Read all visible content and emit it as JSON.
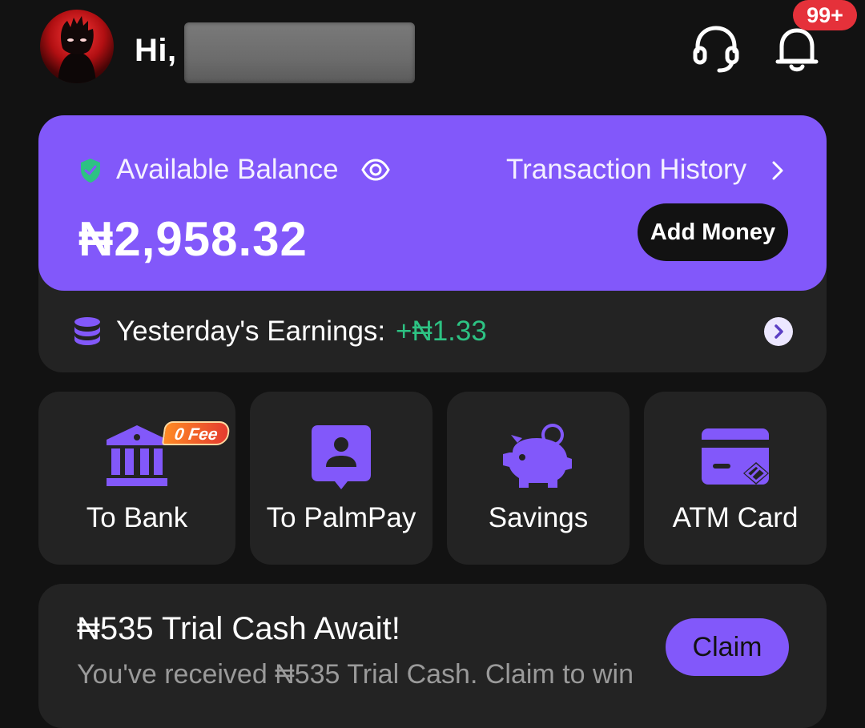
{
  "header": {
    "greeting": "Hi,",
    "notification_badge": "99+",
    "icons": {
      "avatar": "avatar-image",
      "support": "headset-icon",
      "notifications": "bell-icon"
    }
  },
  "balance": {
    "label": "Available Balance",
    "amount": "₦2,958.32",
    "transaction_history": "Transaction History",
    "add_money": "Add Money",
    "icons": {
      "secure": "shield-check-icon",
      "visibility": "eye-icon",
      "chevron": "chevron-right-icon"
    }
  },
  "earnings": {
    "label": "Yesterday's Earnings:",
    "value": "+₦1.33",
    "icons": {
      "coins": "coin-stack-icon",
      "arrow": "chevron-right-circle-icon"
    }
  },
  "actions": [
    {
      "label": "To Bank",
      "icon": "bank-icon",
      "tag": "0 Fee"
    },
    {
      "label": "To PalmPay",
      "icon": "user-chat-icon"
    },
    {
      "label": "Savings",
      "icon": "piggy-bank-icon"
    },
    {
      "label": "ATM Card",
      "icon": "card-icon"
    }
  ],
  "promo": {
    "title": "₦535 Trial Cash Await!",
    "description": "You've received ₦535 Trial Cash. Claim to win",
    "button": "Claim"
  },
  "colors": {
    "background": "#121212",
    "card": "#232323",
    "accent": "#8258fa",
    "positive": "#2dc283",
    "badge": "#e5313a"
  }
}
